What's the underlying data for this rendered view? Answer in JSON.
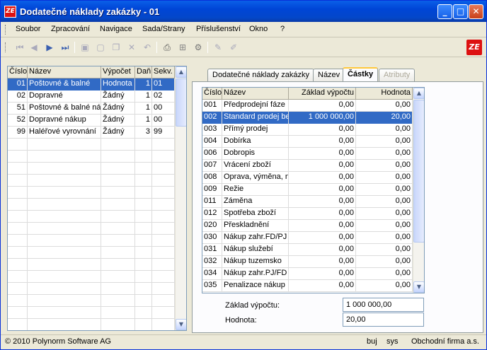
{
  "window": {
    "title": "Dodatečné náklady zakázky - 01",
    "app_icon": "ZE",
    "minimize": "_",
    "maximize": "□",
    "close": "✕"
  },
  "menu": [
    "Soubor",
    "Zpracování",
    "Navigace",
    "Sada/Strany",
    "Příslušenství",
    "Okno",
    "?"
  ],
  "toolbar": {
    "icons": [
      "first-record-icon",
      "previous-record-icon",
      "next-record-icon",
      "last-record-icon",
      "save-icon",
      "new-icon",
      "copy-icon",
      "delete-icon",
      "undo-icon",
      "print-icon",
      "tree-icon",
      "settings-icon",
      "edit-icon",
      "edit-alt-icon"
    ],
    "logo": "ZE"
  },
  "left_grid": {
    "columns": [
      "Číslo",
      "Název",
      "Výpočet",
      "Daň",
      "Sekv."
    ],
    "rows": [
      [
        "01",
        "Poštovné & balné",
        "Hodnota",
        "1",
        "01"
      ],
      [
        "02",
        "Dopravné",
        "Žádný",
        "1",
        "02"
      ],
      [
        "51",
        "Poštovné & balné nák",
        "Žádný",
        "1",
        "00"
      ],
      [
        "52",
        "Dopravné nákup",
        "Žádný",
        "1",
        "00"
      ],
      [
        "99",
        "Haléřové vyrovnání",
        "Žádný",
        "3",
        "99"
      ]
    ],
    "selected_row": 0
  },
  "tabs": [
    {
      "label": "Dodatečné náklady zakázky",
      "state": "normal"
    },
    {
      "label": "Název",
      "state": "normal"
    },
    {
      "label": "Částky",
      "state": "active"
    },
    {
      "label": "Atributy",
      "state": "disabled"
    }
  ],
  "right_grid": {
    "columns": [
      "Číslo",
      "Název",
      "Základ výpočtu",
      "Hodnota"
    ],
    "rows": [
      [
        "001",
        "Předprodejní fáze",
        "0,00",
        "0,00"
      ],
      [
        "002",
        "Standard prodej be",
        "1 000 000,00",
        "20,00"
      ],
      [
        "003",
        "Přímý prodej",
        "0,00",
        "0,00"
      ],
      [
        "004",
        "Dobírka",
        "0,00",
        "0,00"
      ],
      [
        "006",
        "Dobropis",
        "0,00",
        "0,00"
      ],
      [
        "007",
        "Vrácení zboží",
        "0,00",
        "0,00"
      ],
      [
        "008",
        "Oprava, výměna, n",
        "0,00",
        "0,00"
      ],
      [
        "009",
        "Režie",
        "0,00",
        "0,00"
      ],
      [
        "011",
        "Záměna",
        "0,00",
        "0,00"
      ],
      [
        "012",
        "Spotřeba zboží",
        "0,00",
        "0,00"
      ],
      [
        "020",
        "Přeskladnění",
        "0,00",
        "0,00"
      ],
      [
        "030",
        "Nákup zahr.FD/PJ",
        "0,00",
        "0,00"
      ],
      [
        "031",
        "Nákup služebí",
        "0,00",
        "0,00"
      ],
      [
        "032",
        "Nákup tuzemsko",
        "0,00",
        "0,00"
      ],
      [
        "034",
        "Nákup zahr.PJ/FD",
        "0,00",
        "0,00"
      ],
      [
        "035",
        "Penalizace nákup",
        "0,00",
        "0,00"
      ]
    ],
    "selected_row": 1
  },
  "form": {
    "base_label": "Základ výpočtu:",
    "base_value": "1 000 000,00",
    "value_label": "Hodnota:",
    "value_value": "20,00"
  },
  "status": {
    "copyright": "© 2010 Polynorm Software AG",
    "user": "buj",
    "system": "sys",
    "company": "Obchodní firma a.s."
  },
  "colors": {
    "selection": "#316ac5",
    "titlebar": "#0a5fe8",
    "accent_tab": "#ffc83c"
  }
}
